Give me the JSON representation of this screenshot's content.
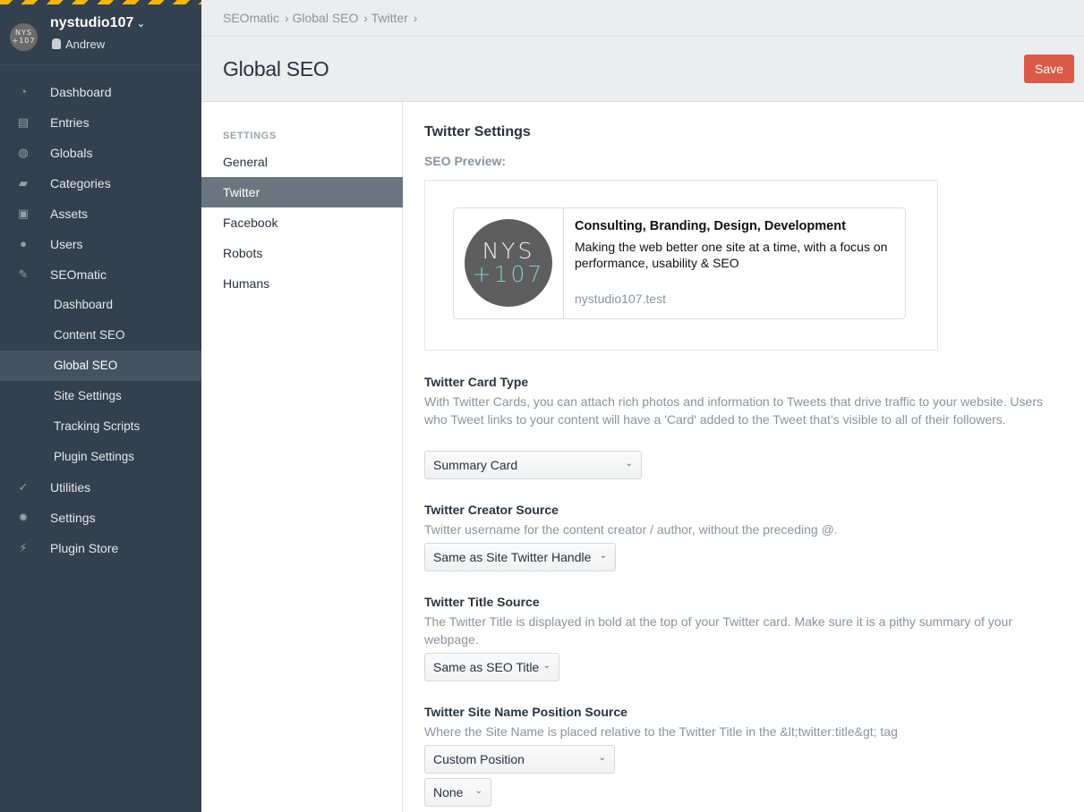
{
  "site": {
    "name": "nystudio107",
    "logo_text_top": "NYS",
    "logo_text_bottom": "+107",
    "user": "Andrew"
  },
  "nav": [
    {
      "label": "Dashboard",
      "icon": "dashboard-icon"
    },
    {
      "label": "Entries",
      "icon": "entries-icon"
    },
    {
      "label": "Globals",
      "icon": "globe-icon"
    },
    {
      "label": "Categories",
      "icon": "folder-icon"
    },
    {
      "label": "Assets",
      "icon": "image-icon"
    },
    {
      "label": "Users",
      "icon": "users-icon"
    },
    {
      "label": "SEOmatic",
      "icon": "seomatic-icon"
    }
  ],
  "seomatic_sub": [
    "Dashboard",
    "Content SEO",
    "Global SEO",
    "Site Settings",
    "Tracking Scripts",
    "Plugin Settings"
  ],
  "nav_bottom": [
    {
      "label": "Utilities",
      "icon": "wrench-icon"
    },
    {
      "label": "Settings",
      "icon": "gear-icon"
    },
    {
      "label": "Plugin Store",
      "icon": "plug-icon"
    }
  ],
  "breadcrumb": [
    "SEOmatic",
    "Global SEO",
    "Twitter"
  ],
  "page_title": "Global SEO",
  "save_label": "Save",
  "settings_nav": {
    "heading": "SETTINGS",
    "items": [
      "General",
      "Twitter",
      "Facebook",
      "Robots",
      "Humans"
    ],
    "active": "Twitter"
  },
  "main": {
    "section_title": "Twitter Settings",
    "preview_label": "SEO Preview:",
    "card": {
      "logo_top": "NYS",
      "logo_bottom": "+107",
      "title": "Consulting, Branding, Design, Development",
      "description": "Making the web better one site at a time, with a focus on performance, usability & SEO",
      "domain": "nystudio107.test"
    },
    "fields": [
      {
        "title": "Twitter Card Type",
        "desc": "With Twitter Cards, you can attach rich photos and information to Tweets that drive traffic to your website. Users who Tweet links to your content will have a 'Card' added to the Tweet that’s visible to all of their followers.",
        "value": "Summary Card"
      },
      {
        "title": "Twitter Creator Source",
        "desc": "Twitter username for the content creator / author, without the preceding @.",
        "value": "Same as Site Twitter Handle"
      },
      {
        "title": "Twitter Title Source",
        "desc": "The Twitter Title is displayed in bold at the top of your Twitter card. Make sure it is a pithy summary of your webpage.",
        "value": "Same as SEO Title"
      },
      {
        "title": "Twitter Site Name Position Source",
        "desc": "Where the Site Name is placed relative to the Twitter Title in the &lt;twitter:title&gt; tag",
        "value": "Custom Position",
        "value2": "None"
      }
    ]
  }
}
